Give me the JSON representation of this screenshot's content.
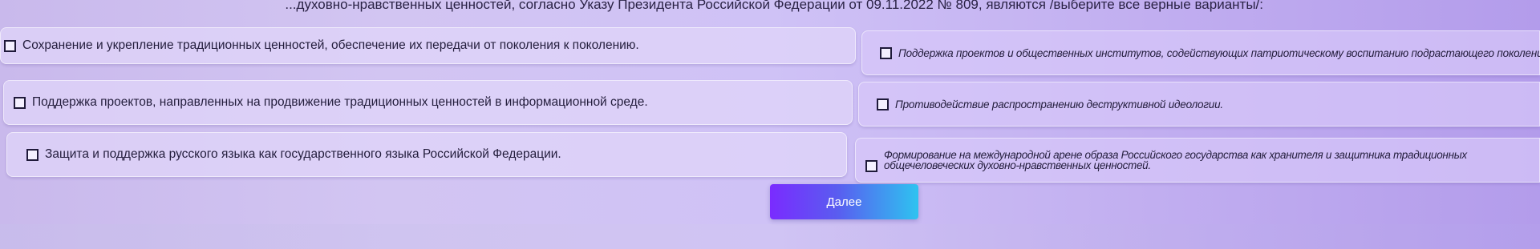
{
  "question": {
    "text": "...духовно-нравственных ценностей, согласно Указу Президента Российской Федерации от 09.11.2022 № 809, являются /выберите все верные варианты/:"
  },
  "options_left": [
    {
      "label": "Сохранение и укрепление традиционных ценностей, обеспечение их передачи от поколения к поколению."
    },
    {
      "label": "Поддержка проектов, направленных на продвижение традиционных ценностей в информационной среде."
    },
    {
      "label": "Защита и поддержка русского языка как государственного языка Российской Федерации."
    }
  ],
  "options_right": [
    {
      "label": "Поддержка проектов и общественных институтов, содействующих патриотическому воспитанию подрастающего поколения."
    },
    {
      "label": "Противодействие распространению деструктивной идеологии."
    },
    {
      "label": "Формирование на международной арене образа Российского государства как хранителя и защитника традиционных общечеловеческих духовно-нравственных ценностей."
    }
  ],
  "next_button": {
    "label": "Далее"
  },
  "colors": {
    "accent_start": "#7a2bff",
    "accent_end": "#2ec3f0",
    "card_bg": "#e1d6fa",
    "text": "#231d3c"
  }
}
